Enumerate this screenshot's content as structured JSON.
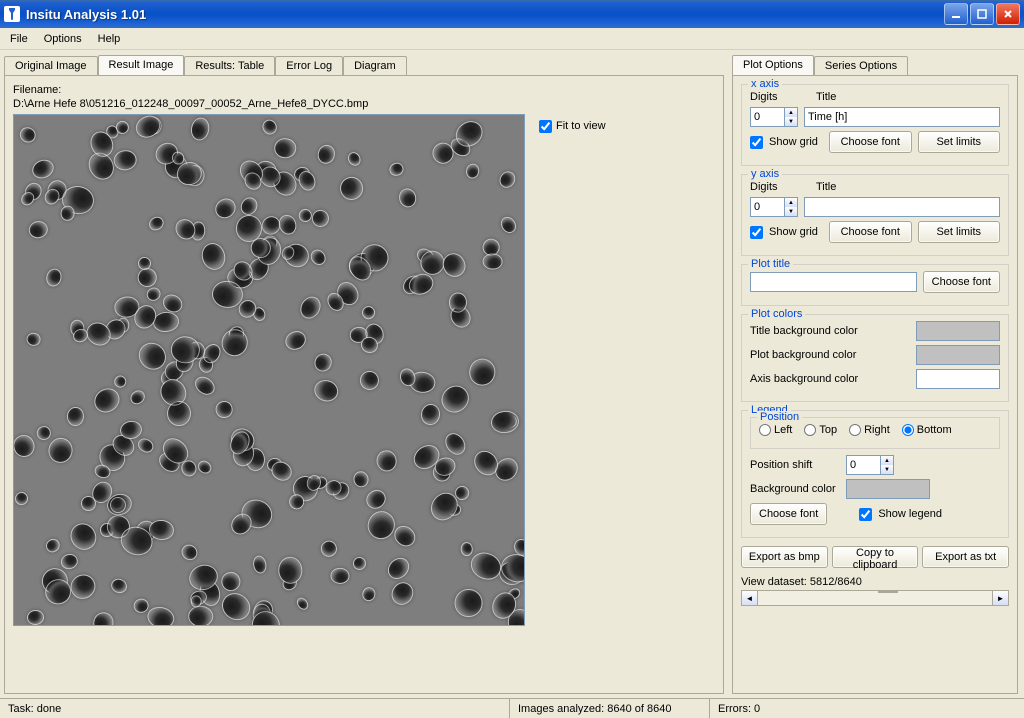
{
  "window": {
    "title": "Insitu Analysis 1.01"
  },
  "menu": {
    "file": "File",
    "options": "Options",
    "help": "Help"
  },
  "leftTabs": {
    "original": "Original Image",
    "result": "Result Image",
    "table": "Results: Table",
    "errorlog": "Error Log",
    "diagram": "Diagram"
  },
  "file": {
    "label": "Filename:",
    "path": "D:\\Arne Hefe 8\\051216_012248_00097_00052_Arne_Hefe8_DYCC.bmp"
  },
  "fit": {
    "label": "Fit to view",
    "checked": true
  },
  "rightTabs": {
    "plotOptions": "Plot Options",
    "seriesOptions": "Series Options"
  },
  "xaxis": {
    "legend": "x axis",
    "digitsLabel": "Digits",
    "digits": "0",
    "titleLabel": "Title",
    "title": "Time [h]",
    "showGrid": "Show grid",
    "showGridChecked": true,
    "chooseFont": "Choose font",
    "setLimits": "Set limits"
  },
  "yaxis": {
    "legend": "y axis",
    "digitsLabel": "Digits",
    "digits": "0",
    "titleLabel": "Title",
    "title": "",
    "showGrid": "Show grid",
    "showGridChecked": true,
    "chooseFont": "Choose font",
    "setLimits": "Set limits"
  },
  "plotTitle": {
    "legend": "Plot title",
    "value": "",
    "chooseFont": "Choose font"
  },
  "plotColors": {
    "legend": "Plot colors",
    "titleBg": "Title background color",
    "plotBg": "Plot background color",
    "axisBg": "Axis background color"
  },
  "legendBox": {
    "legend": "Legend",
    "positionLegend": "Position",
    "left": "Left",
    "top": "Top",
    "right": "Right",
    "bottom": "Bottom",
    "selected": "bottom",
    "shiftLabel": "Position shift",
    "shift": "0",
    "bgLabel": "Background color",
    "chooseFont": "Choose font",
    "showLegend": "Show legend",
    "showLegendChecked": true
  },
  "export": {
    "bmp": "Export as bmp",
    "clipboard": "Copy to clipboard",
    "txt": "Export as txt"
  },
  "dataset": {
    "label": "View dataset: 5812/8640"
  },
  "status": {
    "task": "Task: done",
    "analyzed": "Images analyzed: 8640 of 8640",
    "errors": "Errors: 0"
  }
}
